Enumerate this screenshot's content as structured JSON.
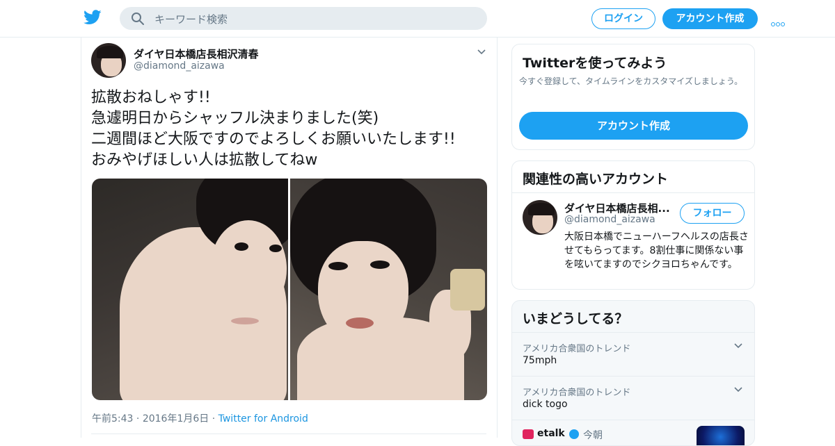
{
  "header": {
    "search_placeholder": "キーワード検索",
    "login_label": "ログイン",
    "signup_label": "アカウント作成",
    "brand_color": "#1da1f2"
  },
  "tweet": {
    "name": "ダイヤ日本橋店長相沢清春",
    "handle": "@diamond_aizawa",
    "lines": [
      "拡散おねしゃす!!",
      "急遽明日からシャッフル決まりました(笑)",
      "二週間ほど大阪ですのでよろしくお願いいたします!!",
      "おみやげほしい人は拡散してねw"
    ],
    "time": "午前5:43",
    "date": "2016年1月6日",
    "source": "Twitter for Android"
  },
  "sidebar": {
    "signup_card": {
      "title": "Twitterを使ってみよう",
      "description": "今すぐ登録して、タイムラインをカスタマイズしましょう。",
      "button_label": "アカウント作成"
    },
    "related_card": {
      "title": "関連性の高いアカウント",
      "name": "ダイヤ日本橋店長相...",
      "handle": "@diamond_aizawa",
      "follow_label": "フォロー",
      "bio": "大阪日本橋でニューハーフヘルスの店長させてもらってます。8割仕事に関係ない事を呟いてますのでシクヨロちゃんです。"
    },
    "trends_card": {
      "title": "いまどうしてる？",
      "trends": [
        {
          "context": "アメリカ合衆国のトレンド",
          "name": "75mph"
        },
        {
          "context": "アメリカ合衆国のトレンド",
          "name": "dick togo"
        }
      ],
      "news": {
        "account": "etalk",
        "time": "今朝"
      }
    }
  }
}
